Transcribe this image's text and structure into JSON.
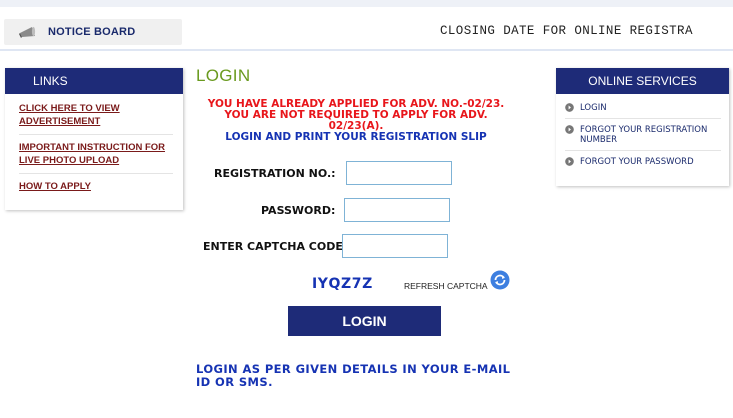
{
  "notice": {
    "tab_label": "NOTICE BOARD",
    "marquee_text": "CLOSING DATE FOR ONLINE REGISTRA"
  },
  "links": {
    "heading": "LINKS",
    "items": [
      {
        "label": "CLICK HERE TO VIEW ADVERTISEMENT"
      },
      {
        "label": "IMPORTANT INSTRUCTION FOR LIVE PHOTO UPLOAD"
      },
      {
        "label": "HOW TO APPLY"
      }
    ]
  },
  "login": {
    "title": "LOGIN",
    "alert_red": "YOU HAVE ALREADY APPLIED FOR ADV. NO.-02/23. YOU ARE NOT REQUIRED TO APPLY FOR ADV. 02/23(A).",
    "alert_blue": "LOGIN AND PRINT YOUR REGISTRATION SLIP",
    "registration_label": "REGISTRATION NO.:",
    "registration_value": "",
    "password_label": "PASSWORD:",
    "password_value": "",
    "captcha_label": "ENTER CAPTCHA CODE:",
    "captcha_value": "",
    "captcha_code": "IYQZ7Z",
    "refresh_label": "REFRESH CAPTCHA",
    "button_label": "LOGIN",
    "hint": "LOGIN AS PER GIVEN DETAILS IN YOUR E-MAIL ID OR SMS."
  },
  "services": {
    "heading": "ONLINE SERVICES",
    "items": [
      {
        "label": "LOGIN"
      },
      {
        "label": "FORGOT YOUR REGISTRATION NUMBER"
      },
      {
        "label": "FORGOT YOUR PASSWORD"
      }
    ]
  },
  "colors": {
    "navy": "#1e2b78",
    "alert_red": "#e8161b",
    "link_blue": "#1633b3",
    "title_green": "#6a9a1f",
    "link_maroon": "#7a1a1a"
  },
  "icons": {
    "notice": "megaphone-icon",
    "refresh": "refresh-icon",
    "service_bullet": "circle-arrow-icon"
  }
}
